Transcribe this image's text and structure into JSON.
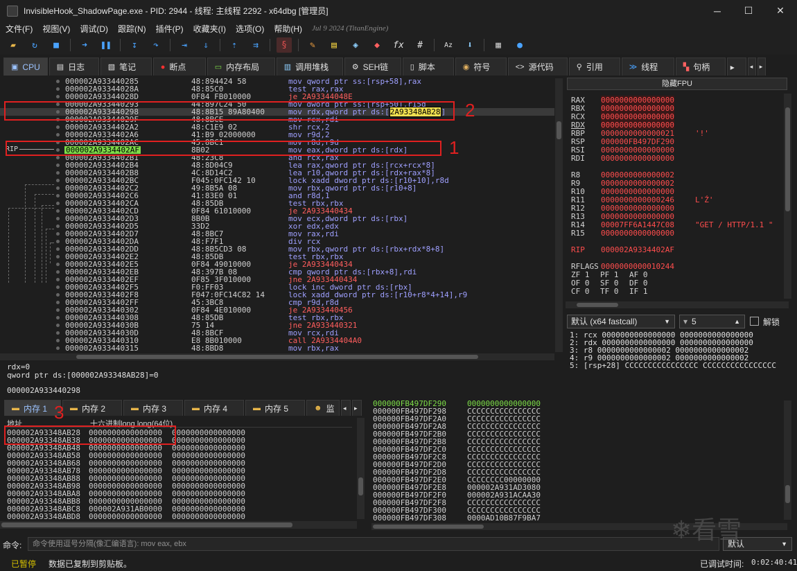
{
  "window": {
    "title": "InvisibleHook_ShadowPage.exe - PID: 2944 - 线程: 主线程 2292 - x64dbg [管理员]",
    "controls": [
      "─",
      "☐",
      "✕"
    ]
  },
  "menu": {
    "items": [
      "文件(F)",
      "视图(V)",
      "调试(D)",
      "跟踪(N)",
      "插件(P)",
      "收藏夹(I)",
      "选项(O)",
      "帮助(H)"
    ],
    "build": "Jul 9 2024 (TitanEngine)"
  },
  "tabs": [
    {
      "label": "CPU",
      "icon": "cpu-icon"
    },
    {
      "label": "日志",
      "icon": "log-icon"
    },
    {
      "label": "笔记",
      "icon": "notes-icon"
    },
    {
      "label": "断点",
      "icon": "breakpoint-icon"
    },
    {
      "label": "内存布局",
      "icon": "memory-map-icon"
    },
    {
      "label": "调用堆栈",
      "icon": "call-stack-icon"
    },
    {
      "label": "SEH链",
      "icon": "seh-icon"
    },
    {
      "label": "脚本",
      "icon": "script-icon"
    },
    {
      "label": "符号",
      "icon": "symbols-icon"
    },
    {
      "label": "源代码",
      "icon": "source-icon"
    },
    {
      "label": "引用",
      "icon": "references-icon"
    },
    {
      "label": "线程",
      "icon": "threads-icon"
    },
    {
      "label": "句柄",
      "icon": "handles-icon"
    }
  ],
  "disasm": {
    "rip_label": "RIP",
    "rows": [
      {
        "addr": "000002A933440285",
        "bytes": "48:894424 58",
        "ins": "mov qword ptr ss:[rsp+58],rax"
      },
      {
        "addr": "000002A93344028A",
        "bytes": "48:85C0",
        "ins": "test rax,rax"
      },
      {
        "addr": "000002A93344028D",
        "bytes": "0F84 FB010000",
        "ins": "je 2A93344048E"
      },
      {
        "addr": "000002A933440293",
        "bytes": "44:897C24 50",
        "ins": "mov dword ptr ss:[rsp+50],r15d"
      },
      {
        "addr": "000002A933440298",
        "bytes": "48:8B15 89A80400",
        "ins_pre": "mov rdx,qword ptr ds:[",
        "ins_hl": "2A93348AB28",
        "ins_post": "]"
      },
      {
        "addr": "000002A93344029F",
        "bytes": "48:8BCE",
        "ins": "mov rcx,rdi"
      },
      {
        "addr": "000002A9334402A2",
        "bytes": "48:C1E9 02",
        "ins": "shr rcx,2"
      },
      {
        "addr": "000002A9334402A6",
        "bytes": "41:B9 02000000",
        "ins": "mov r9d,2"
      },
      {
        "addr": "000002A9334402AC",
        "bytes": "45:8BC1",
        "ins": "mov r8d,r9d"
      },
      {
        "addr": "000002A9334402AF",
        "bytes": "8B02",
        "ins": "mov eax,dword ptr ds:[rdx]"
      },
      {
        "addr": "000002A9334402B1",
        "bytes": "48:23C8",
        "ins": "and rcx,rax"
      },
      {
        "addr": "000002A9334402B4",
        "bytes": "48:8D04C9",
        "ins": "lea rax,qword ptr ds:[rcx+rcx*8]"
      },
      {
        "addr": "000002A9334402B8",
        "bytes": "4C:8D14C2",
        "ins": "lea r10,qword ptr ds:[rdx+rax*8]"
      },
      {
        "addr": "000002A9334402BC",
        "bytes": "F045:0FC142 10",
        "ins": "lock xadd dword ptr ds:[r10+10],r8d"
      },
      {
        "addr": "000002A9334402C2",
        "bytes": "49:8B5A 08",
        "ins": "mov rbx,qword ptr ds:[r10+8]"
      },
      {
        "addr": "000002A9334402C6",
        "bytes": "41:83E0 01",
        "ins": "and r8d,1"
      },
      {
        "addr": "000002A9334402CA",
        "bytes": "48:85DB",
        "ins": "test rbx,rbx"
      },
      {
        "addr": "000002A9334402CD",
        "bytes": "0F84 61010000",
        "ins": "je 2A933440434",
        "jmp": true
      },
      {
        "addr": "000002A9334402D3",
        "bytes": "8B0B",
        "ins": "mov ecx,dword ptr ds:[rbx]"
      },
      {
        "addr": "000002A9334402D5",
        "bytes": "33D2",
        "ins": "xor edx,edx"
      },
      {
        "addr": "000002A9334402D7",
        "bytes": "48:8BC7",
        "ins": "mov rax,rdi"
      },
      {
        "addr": "000002A9334402DA",
        "bytes": "48:F7F1",
        "ins": "div rcx"
      },
      {
        "addr": "000002A9334402DD",
        "bytes": "48:8B5CD3 08",
        "ins": "mov rbx,qword ptr ds:[rbx+rdx*8+8]"
      },
      {
        "addr": "000002A9334402E2",
        "bytes": "48:85DB",
        "ins": "test rbx,rbx"
      },
      {
        "addr": "000002A9334402E5",
        "bytes": "0F84 49010000",
        "ins": "je 2A933440434",
        "jmp": true
      },
      {
        "addr": "000002A9334402EB",
        "bytes": "48:397B 08",
        "ins": "cmp qword ptr ds:[rbx+8],rdi"
      },
      {
        "addr": "000002A9334402EF",
        "bytes": "0F85 3F010000",
        "ins": "jne 2A933440434",
        "jmp": true
      },
      {
        "addr": "000002A9334402F5",
        "bytes": "F0:FF03",
        "ins": "lock inc dword ptr ds:[rbx]"
      },
      {
        "addr": "000002A9334402F8",
        "bytes": "F047:0FC14C82 14",
        "ins": "lock xadd dword ptr ds:[r10+r8*4+14],r9"
      },
      {
        "addr": "000002A9334402FF",
        "bytes": "45:3BC8",
        "ins": "cmp r9d,r8d"
      },
      {
        "addr": "000002A933440302",
        "bytes": "0F84 4E010000",
        "ins": "je 2A933440456",
        "jmp": true
      },
      {
        "addr": "000002A933440308",
        "bytes": "48:85DB",
        "ins": "test rbx,rbx"
      },
      {
        "addr": "000002A93344030B",
        "bytes": "75 14",
        "ins": "jne 2A933440321",
        "jmp": true
      },
      {
        "addr": "000002A93344030D",
        "bytes": "48:8BCF",
        "ins": "mov rcx,rdi"
      },
      {
        "addr": "000002A933440310",
        "bytes": "E8 8B010000",
        "ins": "call 2A9334404A0",
        "call": true
      },
      {
        "addr": "000002A933440315",
        "bytes": "48:8BD8",
        "ins": "mov rbx,rax"
      }
    ]
  },
  "info": {
    "line1": "rdx=0",
    "line2": "qword ptr ds:[000002A93348AB28]=0",
    "addr": "000002A933440298"
  },
  "registers": {
    "header": "隐藏FPU",
    "general": [
      {
        "name": "RAX",
        "value": "0000000000000000"
      },
      {
        "name": "RBX",
        "value": "0000000000000000"
      },
      {
        "name": "RCX",
        "value": "0000000000000000"
      },
      {
        "name": "RDX",
        "value": "0000000000000000"
      },
      {
        "name": "RBP",
        "value": "0000000000000021",
        "comment": "'!'"
      },
      {
        "name": "RSP",
        "value": "000000FB497DF290"
      },
      {
        "name": "RSI",
        "value": "0000000000000000"
      },
      {
        "name": "RDI",
        "value": "0000000000000000"
      }
    ],
    "extended": [
      {
        "name": "R8",
        "value": "0000000000000002"
      },
      {
        "name": "R9",
        "value": "0000000000000002"
      },
      {
        "name": "R10",
        "value": "0000000000000000"
      },
      {
        "name": "R11",
        "value": "0000000000000246",
        "comment": "L'Ź'"
      },
      {
        "name": "R12",
        "value": "0000000000000000"
      },
      {
        "name": "R13",
        "value": "0000000000000000"
      },
      {
        "name": "R14",
        "value": "00007FF6A1447C08",
        "comment": "\"GET / HTTP/1.1 \""
      },
      {
        "name": "R15",
        "value": "0000000000000000"
      }
    ],
    "rip": {
      "name": "RIP",
      "value": "000002A9334402AF"
    },
    "rflags": {
      "name": "RFLAGS",
      "value": "0000000000010244"
    },
    "flags": [
      [
        "ZF 1",
        "PF 1",
        "AF 0"
      ],
      [
        "OF 0",
        "SF 0",
        "DF 0"
      ],
      [
        "CF 0",
        "TF 0",
        "IF 1"
      ]
    ]
  },
  "callconv": {
    "convention": "默认 (x64 fastcall)",
    "count": "5",
    "unlock_label": "解锁"
  },
  "args": [
    "1: rcx 0000000000000000 0000000000000000",
    "2: rdx 0000000000000000 0000000000000000",
    "3: r8 0000000000000002 0000000000000002",
    "4: r9 0000000000000002 0000000000000002",
    "5: [rsp+28] CCCCCCCCCCCCCCCC CCCCCCCCCCCCCCCC"
  ],
  "dump_tabs": [
    "内存 1",
    "内存 2",
    "内存 3",
    "内存 4",
    "内存 5",
    "监"
  ],
  "dump": {
    "col_addr": "地址",
    "col_hex": "十六进制long long(64位)",
    "rows": [
      [
        "000002A93348AB28",
        "0000000000000000",
        "0000000000000000"
      ],
      [
        "000002A93348AB38",
        "0000000000000000",
        "0000000000000000"
      ],
      [
        "000002A93348AB48",
        "0000000000000000",
        "0000000000000000"
      ],
      [
        "000002A93348AB58",
        "0000000000000000",
        "0000000000000000"
      ],
      [
        "000002A93348AB68",
        "0000000000000000",
        "0000000000000000"
      ],
      [
        "000002A93348AB78",
        "0000000000000000",
        "0000000000000000"
      ],
      [
        "000002A93348AB88",
        "0000000000000000",
        "0000000000000000"
      ],
      [
        "000002A93348AB98",
        "0000000000000000",
        "0000000000000000"
      ],
      [
        "000002A93348ABA8",
        "0000000000000000",
        "0000000000000000"
      ],
      [
        "000002A93348ABB8",
        "0000000000000000",
        "0000000000000000"
      ],
      [
        "000002A93348ABC8",
        "000002A931AB0000",
        "0000000000000000"
      ],
      [
        "000002A93348ABD8",
        "0000000000000000",
        "0000000000000000"
      ]
    ]
  },
  "stack": [
    [
      "000000FB497DF290",
      "0000000000000000"
    ],
    [
      "000000FB497DF298",
      "CCCCCCCCCCCCCCCC"
    ],
    [
      "000000FB497DF2A0",
      "CCCCCCCCCCCCCCCC"
    ],
    [
      "000000FB497DF2A8",
      "CCCCCCCCCCCCCCCC"
    ],
    [
      "000000FB497DF2B0",
      "CCCCCCCCCCCCCCCC"
    ],
    [
      "000000FB497DF2B8",
      "CCCCCCCCCCCCCCCC"
    ],
    [
      "000000FB497DF2C0",
      "CCCCCCCCCCCCCCCC"
    ],
    [
      "000000FB497DF2C8",
      "CCCCCCCCCCCCCCCC"
    ],
    [
      "000000FB497DF2D0",
      "CCCCCCCCCCCCCCCC"
    ],
    [
      "000000FB497DF2D8",
      "CCCCCCCCCCCCCCCC"
    ],
    [
      "000000FB497DF2E0",
      "CCCCCCCC00000000"
    ],
    [
      "000000FB497DF2E8",
      "000002A931AD3080"
    ],
    [
      "000000FB497DF2F0",
      "000002A931ACAA30"
    ],
    [
      "000000FB497DF2F8",
      "CCCCCCCCCCCCCCCC"
    ],
    [
      "000000FB497DF300",
      "CCCCCCCCCCCCCCCC"
    ],
    [
      "000000FB497DF308",
      "0000AD10B87F9BA7"
    ]
  ],
  "command": {
    "label": "命令:",
    "placeholder": "命令使用逗号分隔(像汇编语言): mov eax, ebx",
    "mode": "默认"
  },
  "status": {
    "state": "已暂停",
    "message": "数据已复制到剪贴板。",
    "time_label": "已调试时间:",
    "time_value": "0:02:40:41"
  },
  "annotations": [
    "1",
    "2",
    "3"
  ],
  "watermark": "看雪"
}
